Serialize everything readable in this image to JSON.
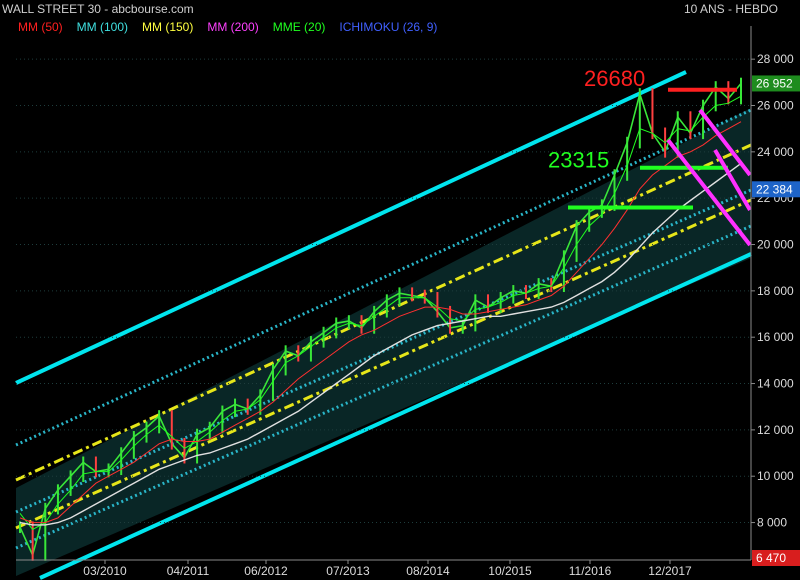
{
  "header": {
    "title": "WALL STREET 30 - abcbourse.com",
    "period": "10 ANS - HEBDO"
  },
  "legend": [
    {
      "label": "MM (50)",
      "color": "#ff2020"
    },
    {
      "label": "MM (100)",
      "color": "#40e0e0"
    },
    {
      "label": "MM (150)",
      "color": "#ffff40"
    },
    {
      "label": "MM (200)",
      "color": "#ff40ff"
    },
    {
      "label": "MME (20)",
      "color": "#20ff20"
    },
    {
      "label": "ICHIMOKU (26, 9)",
      "color": "#4060ff"
    }
  ],
  "chart_data": {
    "type": "line",
    "ylim": [
      6470,
      29000
    ],
    "yticks": [
      "28 000",
      "26 000",
      "24 000",
      "22 000",
      "20 000",
      "18 000",
      "16 000",
      "14 000",
      "12 000",
      "10 000",
      "8 000"
    ],
    "ytick_values": [
      28000,
      26000,
      24000,
      22000,
      20000,
      18000,
      16000,
      14000,
      12000,
      10000,
      8000
    ],
    "x_labels": [
      "03/2010",
      "04/2011",
      "06/2012",
      "07/2013",
      "08/2014",
      "10/2015",
      "11/2016",
      "12/2017"
    ],
    "price_tags": [
      {
        "label": "26 952",
        "value": 26952,
        "bg": "#1e8c1e"
      },
      {
        "label": "22 384",
        "value": 22384,
        "bg": "#1e64c8"
      },
      {
        "label": "6 470",
        "value": 6470,
        "bg": "#d81e1e"
      }
    ],
    "annotations": [
      {
        "text": "26680",
        "value": 26680,
        "color": "#ff2020"
      },
      {
        "text": "23315",
        "value": 23315,
        "color": "#20ff20"
      }
    ],
    "series": [
      {
        "name": "Price",
        "values": [
          7800,
          6600,
          8600,
          9400,
          10000,
          10600,
          10200,
          10300,
          11000,
          11700,
          12100,
          12600,
          11400,
          10800,
          11800,
          12100,
          12800,
          13100,
          12900,
          13500,
          14600,
          15400,
          15200,
          15800,
          16200,
          16600,
          16700,
          16400,
          17100,
          17600,
          17900,
          17800,
          17700,
          17100,
          16400,
          16500,
          17600,
          17300,
          17700,
          18000,
          17900,
          18300,
          18200,
          19500,
          20800,
          21400,
          21700,
          23000,
          24400,
          26500,
          24800,
          24000,
          25500,
          24800,
          26000,
          26800,
          26300,
          26950
        ]
      },
      {
        "name": "MME (20)",
        "values": [
          8400,
          7700,
          8000,
          8800,
          9400,
          10100,
          10200,
          10200,
          10700,
          11300,
          11800,
          12200,
          11700,
          11200,
          11500,
          11900,
          12400,
          12800,
          12900,
          13300,
          14100,
          14900,
          15200,
          15600,
          16000,
          16400,
          16600,
          16500,
          16900,
          17300,
          17700,
          17700,
          17700,
          17300,
          16800,
          16700,
          17200,
          17300,
          17500,
          17800,
          17900,
          18100,
          18200,
          19000,
          20000,
          20800,
          21300,
          22200,
          23400,
          25000,
          24800,
          24400,
          25000,
          24900,
          25500,
          26000,
          26100,
          26400
        ]
      },
      {
        "name": "MM (50)",
        "values": [
          8200,
          8000,
          8000,
          8200,
          8700,
          9200,
          9700,
          10000,
          10300,
          10600,
          11000,
          11400,
          11600,
          11500,
          11500,
          11600,
          11900,
          12200,
          12500,
          12800,
          13200,
          13700,
          14200,
          14600,
          15000,
          15400,
          15800,
          16100,
          16300,
          16600,
          16900,
          17100,
          17300,
          17300,
          17200,
          17000,
          17000,
          17100,
          17200,
          17300,
          17400,
          17600,
          17800,
          18200,
          18800,
          19400,
          20000,
          20700,
          21500,
          22400,
          23000,
          23400,
          23800,
          24000,
          24300,
          24700,
          25000,
          25300
        ]
      },
      {
        "name": "MM (100)",
        "values": [
          8000,
          7900,
          7900,
          8000,
          8200,
          8500,
          8800,
          9100,
          9400,
          9700,
          10000,
          10300,
          10500,
          10700,
          10900,
          11000,
          11200,
          11400,
          11600,
          11900,
          12200,
          12500,
          12800,
          13200,
          13600,
          14000,
          14400,
          14800,
          15200,
          15500,
          15800,
          16100,
          16300,
          16500,
          16600,
          16700,
          16800,
          16900,
          16900,
          17000,
          17100,
          17200,
          17300,
          17500,
          17800,
          18100,
          18400,
          18800,
          19300,
          19900,
          20500,
          21000,
          21500,
          21900,
          22300,
          22700,
          23100,
          23500
        ]
      }
    ]
  }
}
